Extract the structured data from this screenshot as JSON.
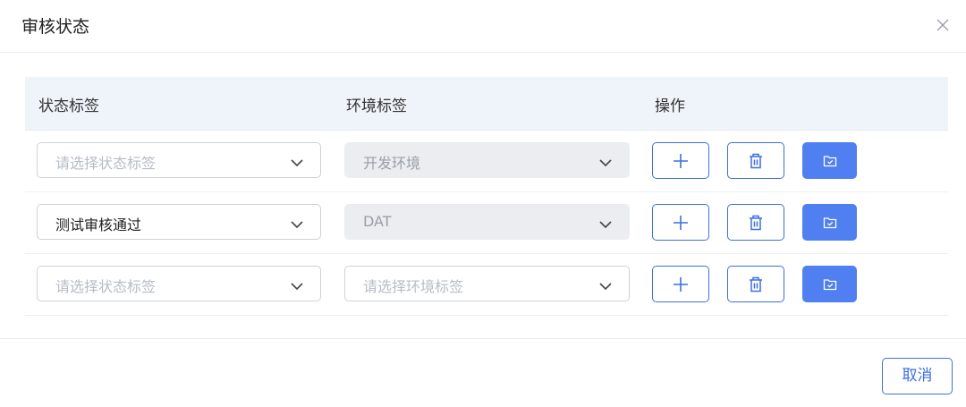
{
  "dialog": {
    "title": "审核状态"
  },
  "table": {
    "headers": {
      "status_tag": "状态标签",
      "env_tag": "环境标签",
      "actions": "操作"
    },
    "rows": [
      {
        "status": {
          "value": "",
          "placeholder": "请选择状态标签"
        },
        "env": {
          "value": "开发环境",
          "placeholder": "请选择环境标签",
          "disabled": true
        }
      },
      {
        "status": {
          "value": "测试审核通过",
          "placeholder": "请选择状态标签"
        },
        "env": {
          "value": "DAT",
          "placeholder": "请选择环境标签",
          "disabled": true
        }
      },
      {
        "status": {
          "value": "",
          "placeholder": "请选择状态标签"
        },
        "env": {
          "value": "",
          "placeholder": "请选择环境标签",
          "disabled": false
        }
      }
    ]
  },
  "icons": {
    "close": "close-icon",
    "chevron": "chevron-down-icon",
    "add": "plus-icon",
    "delete": "trash-icon",
    "folder": "folder-check-icon"
  },
  "colors": {
    "primary": "#3d6fe0",
    "primary_fill": "#4f7ff0",
    "header_bg": "#eff3fa",
    "disabled_bg": "#ebedf1",
    "placeholder": "#b7bcc5"
  },
  "footer": {
    "cancel_label": "取消"
  }
}
